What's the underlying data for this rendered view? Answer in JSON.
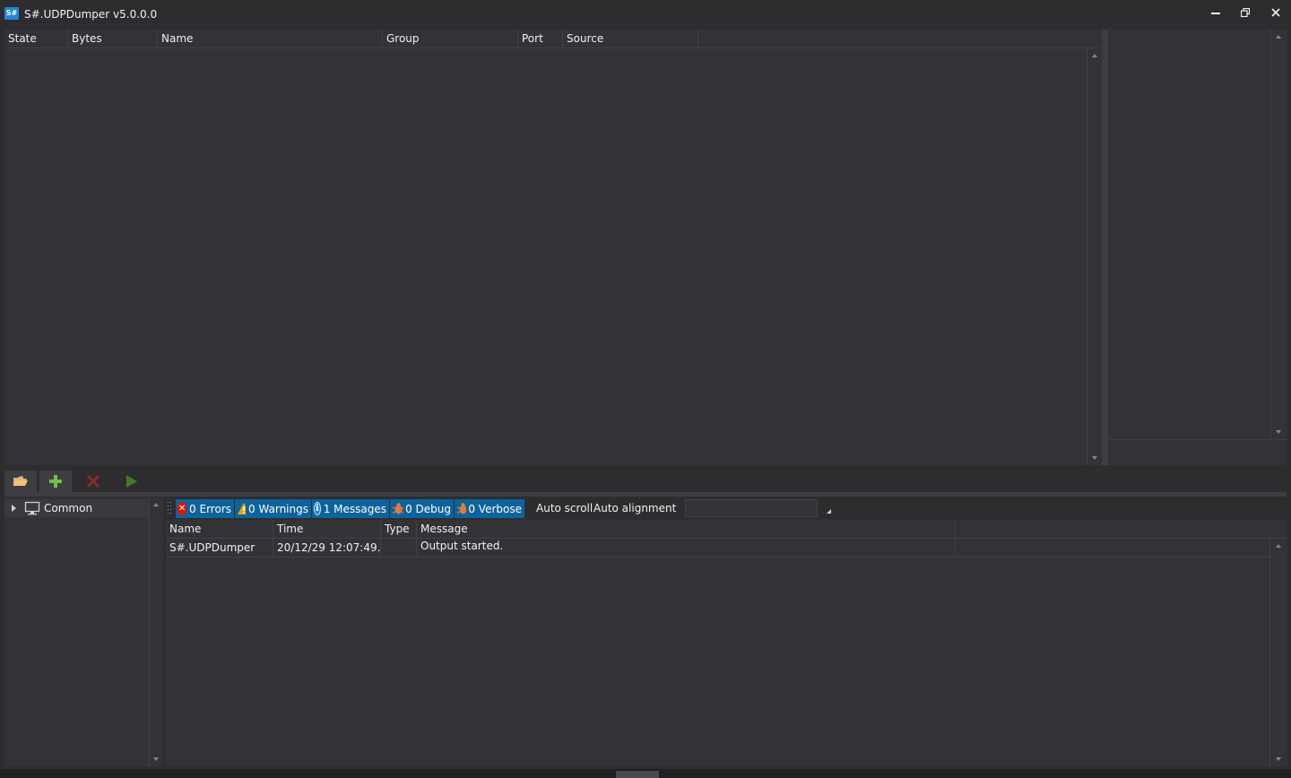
{
  "window": {
    "icon_text": "S#",
    "title": "S#.UDPDumper v5.0.0.0"
  },
  "sources_grid": {
    "columns": [
      "State",
      "Bytes",
      "Name",
      "Group",
      "Port",
      "Source"
    ]
  },
  "tree": {
    "items": [
      {
        "label": "Common"
      }
    ]
  },
  "log_filters": {
    "errors": "0 Errors",
    "warnings": "0 Warnings",
    "messages": "1 Messages",
    "debug": "0 Debug",
    "verbose": "0 Verbose",
    "auto_scroll": "Auto scroll",
    "auto_alignment": "Auto alignment",
    "search_value": ""
  },
  "log_grid": {
    "columns": [
      "Name",
      "Time",
      "Type",
      "Message"
    ],
    "rows": [
      {
        "name": "S#.UDPDumper",
        "time": "20/12/29 12:07:49....",
        "type": "",
        "message": "Output started."
      }
    ]
  },
  "colors": {
    "background": "#2d2d30",
    "panel": "#333337",
    "accent": "#0e639c",
    "error": "#e51400",
    "warning": "#f0a30a",
    "add": "#6cc24a",
    "delete": "#8b2d22",
    "play": "#3f7a2a"
  }
}
